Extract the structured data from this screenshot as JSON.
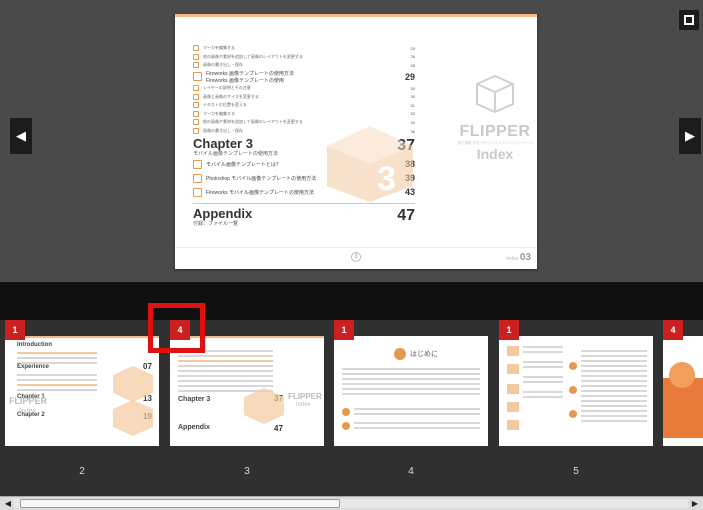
{
  "main_page": {
    "toc_small_entries_top": [
      {
        "text": "マーカを編集する",
        "page": "25"
      },
      {
        "text": "他の画像や素材を追加して画像のレイアウトを変更する",
        "page": "26"
      },
      {
        "text": "画像の書き出し・保存",
        "page": "28"
      }
    ],
    "section_fireworks": {
      "text": "Fireworks 画像テンプレートの使用方法",
      "subtext": "Fireworks 画像テンプレートの使用",
      "page": "29"
    },
    "toc_small_entries_mid": [
      {
        "text": "レイヤーの説明とその注意",
        "page": "30"
      },
      {
        "text": "画像と画像のサイズを変更する",
        "page": "30"
      },
      {
        "text": "テキストの位置を変える",
        "page": "31"
      },
      {
        "text": "マーカを編集する",
        "page": "33"
      },
      {
        "text": "他の画像や素材を追加して画像のレイアウトを変更する",
        "page": "34"
      },
      {
        "text": "画像の書き出し・保存",
        "page": "36"
      }
    ],
    "chapter": {
      "title": "Chapter 3",
      "subtitle": "モバイル画像テンプレートの使用方法",
      "page": "37"
    },
    "chapter_entries": [
      {
        "text": "モバイル画像テンプレートとは？",
        "page": "38"
      },
      {
        "text": "Photoshop モバイル画像テンプレートの使用方法",
        "page": "39"
      },
      {
        "text": "Fireworks モバイル画像テンプレートの使用方法",
        "page": "43"
      }
    ],
    "appendix": {
      "title": "Appendix",
      "subtitle": "付録：ファイル一覧",
      "page": "47"
    },
    "brand_name": "FLIPPER",
    "brand_tag": "電子書籍 作成 デザインテンプレートパッケージ",
    "brand_index": "Index",
    "footer_circle": "3",
    "footer_label": "Index",
    "footer_num": "03"
  },
  "controls": {
    "prev_label": "◀",
    "next_label": "▶"
  },
  "thumbnails": [
    {
      "badge": "1",
      "page_num": "2"
    },
    {
      "badge": "4",
      "page_num": "3"
    },
    {
      "badge": "1",
      "page_num": "4"
    },
    {
      "badge": "1",
      "page_num": "5"
    },
    {
      "badge": "4",
      "page_num": ""
    }
  ],
  "thumb2": {
    "intro": "Introduction",
    "experience": "Experience",
    "ch1": "Chapter 1",
    "ch2": "Chapter 2",
    "n1": "07",
    "n2": "13",
    "n3": "19",
    "brand": "FLIPPER",
    "index": "Index"
  },
  "thumb3": {
    "ch3": "Chapter 3",
    "n37": "37",
    "appendix": "Appendix",
    "n47": "47",
    "brand": "FLIPPER",
    "index": "Index"
  },
  "thumb4": {
    "heading": "はじめに"
  },
  "scrollbar": {
    "left": "◀",
    "right": "▶"
  }
}
